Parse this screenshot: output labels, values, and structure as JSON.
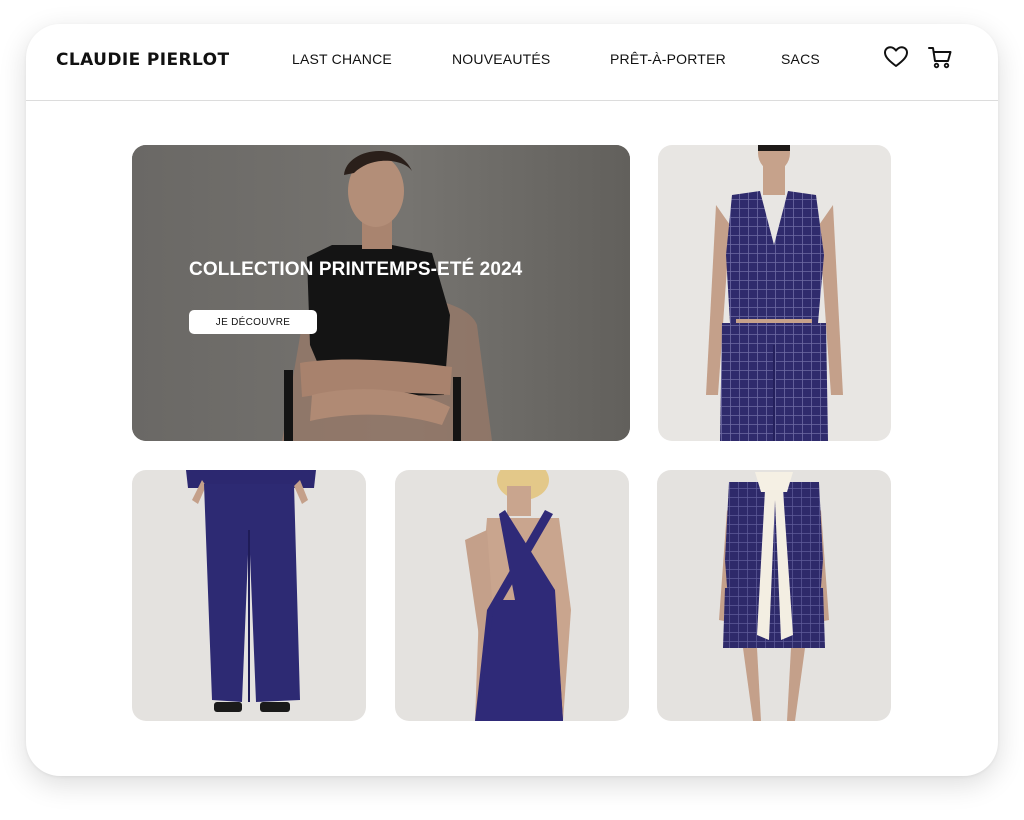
{
  "brand": {
    "logo": "CLAUDIE PIERLOT"
  },
  "nav": {
    "items": [
      {
        "label": "LAST CHANCE"
      },
      {
        "label": "NOUVEAUTÉS"
      },
      {
        "label": "PRÊT-À-PORTER"
      },
      {
        "label": "SACS"
      }
    ]
  },
  "icons": {
    "wishlist": "heart-icon",
    "cart": "cart-icon"
  },
  "hero": {
    "title": "COLLECTION PRINTEMPS-ETÉ 2024",
    "cta_label": "JE DÉCOUVRE"
  },
  "colors": {
    "accent_navy": "#2e2a6e",
    "text": "#111111",
    "hero_overlay": "#6f6d69"
  }
}
